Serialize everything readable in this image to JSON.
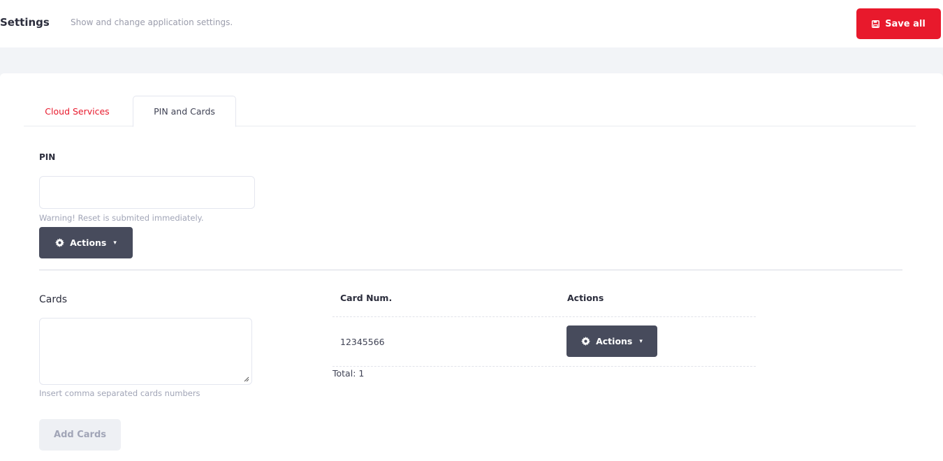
{
  "header": {
    "title": "Settings",
    "subtitle": "Show and change application settings.",
    "save_all_label": "Save all",
    "accent_color": "#e8192c"
  },
  "tabs": [
    {
      "label": "Cloud Services",
      "active": false
    },
    {
      "label": "PIN and Cards",
      "active": true
    }
  ],
  "pin": {
    "label": "PIN",
    "input_value": "",
    "warning": "Warning! Reset is submited immediately.",
    "actions_label": "Actions"
  },
  "cards": {
    "label": "Cards",
    "textarea_value": "",
    "hint": "Insert comma separated cards numbers",
    "add_button_label": "Add Cards",
    "table": {
      "headers": [
        "Card Num.",
        "Actions"
      ],
      "rows": [
        {
          "card_num": "12345566",
          "actions_label": "Actions"
        }
      ],
      "total": "Total: 1"
    }
  },
  "icons": {
    "save": "floppy-disk-icon",
    "actions": "gear-icon",
    "dropdown": "caret-down-icon"
  }
}
